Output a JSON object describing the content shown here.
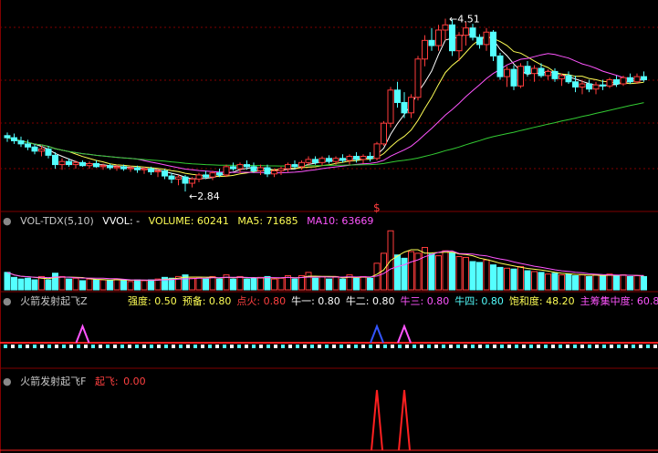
{
  "colors": {
    "up": "#ff3c3c",
    "down": "#54ffff",
    "ma5": "#ffffff",
    "ma10": "#ffff55",
    "ma20": "#ff55ff",
    "ma60": "#33cc33",
    "grid": "#800000",
    "bg": "#000000"
  },
  "price_panel": {
    "high_label": "4.51",
    "low_label": "2.84",
    "signal_mark": "$"
  },
  "vol_header": {
    "name": "VOL-TDX(5,10)",
    "vvol": "VVOL: -",
    "volume": "VOLUME: 60241",
    "ma5": "MA5: 71685",
    "ma10": "MA10: 63669"
  },
  "ind1_header": {
    "name": "火箭发射起飞Z",
    "items": [
      {
        "label": "强度:",
        "value": "0.50",
        "color": "#ffff55"
      },
      {
        "label": "预备:",
        "value": "0.80",
        "color": "#ffff55"
      },
      {
        "label": "点火:",
        "value": "0.80",
        "color": "#ff4040"
      },
      {
        "label": "牛一:",
        "value": "0.80",
        "color": "#ffffff"
      },
      {
        "label": "牛二:",
        "value": "0.80",
        "color": "#ffffff"
      },
      {
        "label": "牛三:",
        "value": "0.80",
        "color": "#ff55ff"
      },
      {
        "label": "牛四:",
        "value": "0.80",
        "color": "#54ffff"
      },
      {
        "label": "饱和度:",
        "value": "48.20",
        "color": "#ffff55"
      },
      {
        "label": "主筹集中度:",
        "value": "60.8",
        "color": "#ff55ff"
      }
    ]
  },
  "ind2_header": {
    "name": "火箭发射起飞F",
    "label": "起飞:",
    "value": "0.00"
  },
  "chart_data": {
    "type": "candlestick",
    "candles": [
      [
        3.38,
        3.41,
        3.32,
        3.36
      ],
      [
        3.36,
        3.4,
        3.3,
        3.33
      ],
      [
        3.33,
        3.37,
        3.27,
        3.3
      ],
      [
        3.3,
        3.34,
        3.24,
        3.27
      ],
      [
        3.27,
        3.3,
        3.2,
        3.23
      ],
      [
        3.23,
        3.28,
        3.18,
        3.25
      ],
      [
        3.25,
        3.28,
        3.16,
        3.19
      ],
      [
        3.19,
        3.22,
        3.06,
        3.1
      ],
      [
        3.1,
        3.16,
        3.05,
        3.13
      ],
      [
        3.13,
        3.16,
        3.08,
        3.1
      ],
      [
        3.1,
        3.14,
        3.06,
        3.12
      ],
      [
        3.12,
        3.14,
        3.08,
        3.09
      ],
      [
        3.09,
        3.13,
        3.06,
        3.11
      ],
      [
        3.11,
        3.14,
        3.07,
        3.08
      ],
      [
        3.08,
        3.11,
        3.05,
        3.09
      ],
      [
        3.09,
        3.11,
        3.05,
        3.07
      ],
      [
        3.07,
        3.1,
        3.04,
        3.08
      ],
      [
        3.08,
        3.1,
        3.04,
        3.06
      ],
      [
        3.06,
        3.09,
        3.03,
        3.07
      ],
      [
        3.07,
        3.09,
        3.02,
        3.05
      ],
      [
        3.05,
        3.08,
        3.01,
        3.06
      ],
      [
        3.06,
        3.08,
        3.0,
        3.03
      ],
      [
        3.03,
        3.06,
        2.98,
        3.04
      ],
      [
        3.04,
        3.06,
        2.96,
        2.99
      ],
      [
        2.99,
        3.02,
        2.92,
        2.96
      ],
      [
        2.96,
        3.0,
        2.9,
        2.98
      ],
      [
        2.98,
        3.0,
        2.84,
        2.92
      ],
      [
        2.92,
        2.98,
        2.88,
        2.96
      ],
      [
        2.96,
        3.02,
        2.93,
        3.0
      ],
      [
        3.0,
        3.04,
        2.96,
        2.98
      ],
      [
        2.98,
        3.04,
        2.95,
        3.02
      ],
      [
        3.02,
        3.06,
        2.98,
        3.0
      ],
      [
        3.0,
        3.1,
        2.98,
        3.08
      ],
      [
        3.08,
        3.12,
        3.04,
        3.06
      ],
      [
        3.06,
        3.12,
        3.02,
        3.1
      ],
      [
        3.1,
        3.14,
        3.05,
        3.08
      ],
      [
        3.08,
        3.12,
        3.02,
        3.04
      ],
      [
        3.04,
        3.1,
        3.0,
        3.07
      ],
      [
        3.07,
        3.1,
        2.98,
        3.01
      ],
      [
        3.01,
        3.06,
        2.98,
        3.04
      ],
      [
        3.04,
        3.08,
        3.0,
        3.06
      ],
      [
        3.06,
        3.12,
        3.03,
        3.1
      ],
      [
        3.1,
        3.14,
        3.06,
        3.08
      ],
      [
        3.08,
        3.14,
        3.05,
        3.12
      ],
      [
        3.12,
        3.18,
        3.09,
        3.15
      ],
      [
        3.15,
        3.18,
        3.1,
        3.12
      ],
      [
        3.12,
        3.18,
        3.09,
        3.16
      ],
      [
        3.16,
        3.19,
        3.11,
        3.13
      ],
      [
        3.13,
        3.18,
        3.1,
        3.16
      ],
      [
        3.16,
        3.2,
        3.12,
        3.14
      ],
      [
        3.14,
        3.2,
        3.1,
        3.18
      ],
      [
        3.18,
        3.22,
        3.12,
        3.15
      ],
      [
        3.15,
        3.2,
        3.11,
        3.18
      ],
      [
        3.18,
        3.22,
        3.13,
        3.16
      ],
      [
        3.16,
        3.32,
        3.14,
        3.3
      ],
      [
        3.3,
        3.52,
        3.28,
        3.5
      ],
      [
        3.5,
        3.85,
        3.46,
        3.82
      ],
      [
        3.82,
        3.9,
        3.65,
        3.7
      ],
      [
        3.7,
        3.8,
        3.55,
        3.6
      ],
      [
        3.6,
        3.78,
        3.55,
        3.75
      ],
      [
        3.75,
        4.15,
        3.72,
        4.12
      ],
      [
        4.12,
        4.35,
        4.05,
        4.3
      ],
      [
        4.3,
        4.42,
        4.2,
        4.25
      ],
      [
        4.25,
        4.45,
        4.2,
        4.4
      ],
      [
        4.4,
        4.51,
        4.3,
        4.45
      ],
      [
        4.45,
        4.5,
        4.15,
        4.2
      ],
      [
        4.2,
        4.38,
        4.1,
        4.35
      ],
      [
        4.35,
        4.48,
        4.25,
        4.42
      ],
      [
        4.42,
        4.46,
        4.3,
        4.33
      ],
      [
        4.33,
        4.36,
        4.22,
        4.26
      ],
      [
        4.26,
        4.42,
        4.2,
        4.38
      ],
      [
        4.38,
        4.4,
        4.1,
        4.15
      ],
      [
        4.15,
        4.18,
        3.92,
        3.95
      ],
      [
        3.95,
        4.05,
        3.85,
        4.02
      ],
      [
        4.02,
        4.06,
        3.82,
        3.86
      ],
      [
        3.86,
        4.08,
        3.84,
        4.05
      ],
      [
        4.05,
        4.1,
        3.95,
        3.98
      ],
      [
        3.98,
        4.06,
        3.9,
        4.03
      ],
      [
        4.03,
        4.08,
        3.94,
        3.96
      ],
      [
        3.96,
        4.02,
        3.92,
        4.0
      ],
      [
        4.0,
        4.03,
        3.9,
        3.93
      ],
      [
        3.93,
        3.98,
        3.86,
        3.96
      ],
      [
        3.96,
        4.0,
        3.88,
        3.9
      ],
      [
        3.9,
        3.96,
        3.8,
        3.85
      ],
      [
        3.85,
        3.92,
        3.78,
        3.88
      ],
      [
        3.88,
        3.92,
        3.8,
        3.83
      ],
      [
        3.83,
        3.9,
        3.78,
        3.87
      ],
      [
        3.87,
        3.92,
        3.82,
        3.86
      ],
      [
        3.86,
        3.94,
        3.84,
        3.92
      ],
      [
        3.92,
        3.96,
        3.85,
        3.88
      ],
      [
        3.88,
        3.96,
        3.86,
        3.94
      ],
      [
        3.94,
        3.98,
        3.88,
        3.9
      ],
      [
        3.9,
        3.98,
        3.88,
        3.95
      ],
      [
        3.95,
        4.0,
        3.9,
        3.92
      ]
    ],
    "volume": [
      2.1,
      1.5,
      1.3,
      1.4,
      1.2,
      1.6,
      1.2,
      2.0,
      1.6,
      1.3,
      1.4,
      1.1,
      1.3,
      1.2,
      1.2,
      1.1,
      1.3,
      1.2,
      1.0,
      1.2,
      1.1,
      1.2,
      1.3,
      1.5,
      1.4,
      1.6,
      1.8,
      1.4,
      1.5,
      1.3,
      1.6,
      1.3,
      1.8,
      1.3,
      1.6,
      1.3,
      1.4,
      1.5,
      1.6,
      1.3,
      1.4,
      1.7,
      1.3,
      1.7,
      2.1,
      1.4,
      1.6,
      1.3,
      1.6,
      1.3,
      1.8,
      1.4,
      1.6,
      1.4,
      3.2,
      4.4,
      7.1,
      4.2,
      3.8,
      4.6,
      4.4,
      5.1,
      4.3,
      4.1,
      4.7,
      4.5,
      4.0,
      3.9,
      3.4,
      3.3,
      3.6,
      3.0,
      2.7,
      2.6,
      2.5,
      2.8,
      2.3,
      2.2,
      2.1,
      1.9,
      2.0,
      1.8,
      1.9,
      1.7,
      1.8,
      1.6,
      1.8,
      1.7,
      1.9,
      1.7,
      1.8,
      1.6,
      1.7,
      1.6
    ],
    "ma_periods": [
      5,
      10,
      20,
      60
    ],
    "price_range": [
      2.7,
      4.62
    ]
  }
}
